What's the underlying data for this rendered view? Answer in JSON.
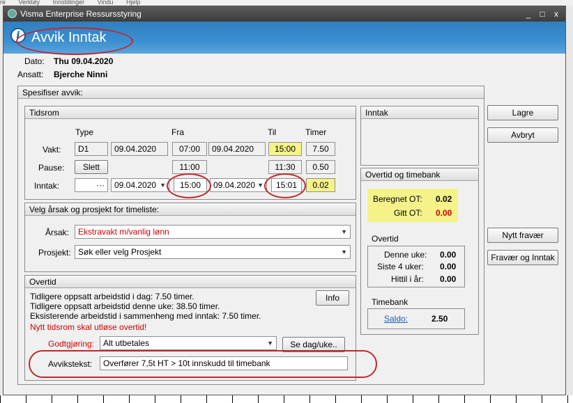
{
  "background_menu": [
    "re",
    "Verktøy",
    "Innstillinger",
    "Vindu",
    "Hjelp"
  ],
  "window": {
    "title": "Visma Enterprise Ressursstyring",
    "min": "_",
    "max": "□",
    "close": "x"
  },
  "header": {
    "title": "Avvik Inntak",
    "icon": "info-icon"
  },
  "info": {
    "date_label": "Dato:",
    "date_value": "Thu 09.04.2020",
    "employee_label": "Ansatt:",
    "employee_value": "Bjerche Ninni"
  },
  "spesifiser": {
    "title": "Spesifiser avvik:"
  },
  "tidsrom": {
    "title": "Tidsrom",
    "col_type": "Type",
    "col_fra": "Fra",
    "col_til": "Til",
    "col_timer": "Timer",
    "vakt": {
      "label": "Vakt:",
      "type": "D1",
      "date_from": "09.04.2020",
      "time_from": "07:00",
      "date_to": "09.04.2020",
      "time_to": "15:00",
      "hours": "7.50"
    },
    "pause": {
      "label": "Pause:",
      "button": "Slett",
      "time_from": "11:00",
      "time_to": "11:30",
      "hours": "0.50"
    },
    "inntak": {
      "label": "Inntak:",
      "ellipsis": "···",
      "date_from": "09.04.2020",
      "time_from": "15:00",
      "date_to": "09.04.2020",
      "time_to": "15:01",
      "hours": "0.02"
    }
  },
  "arsak": {
    "title": "Velg årsak og prosjekt for timeliste:",
    "arsak_label": "Årsak:",
    "arsak_value": "Ekstravakt m/vanlig lønn",
    "prosjekt_label": "Prosjekt:",
    "prosjekt_value": "Søk eller velg Prosjekt"
  },
  "overtid": {
    "title": "Overtid",
    "lines": [
      "Tidligere oppsatt arbeidstid i dag: 7.50 timer.",
      "Tidligere oppsatt arbeidstid denne uke: 38.50 timer.",
      "Eksisterende arbeidstid i sammenheng med inntak: 7.50 timer."
    ],
    "warning": "Nytt tidsrom skal utløse overtid!",
    "info_button": "Info",
    "godtgjoring_label": "Godtgjøring:",
    "godtgjoring_value": "Alt utbetales",
    "se_dag_button": "Se dag/uke..",
    "avvikstekst_label": "Avvikstekst:",
    "avvikstekst_value": "Overfører 7,5t HT > 10t innskudd til timebank"
  },
  "inntak_panel": {
    "title": "Inntak"
  },
  "ot_panel": {
    "title": "Overtid og timebank",
    "beregnet_label": "Beregnet OT:",
    "beregnet_value": "0.02",
    "gitt_label": "Gitt OT:",
    "gitt_value": "0.00",
    "overtid_title": "Overtid",
    "denne_uke_label": "Denne uke:",
    "denne_uke_value": "0.00",
    "siste4_label": "Siste 4 uker:",
    "siste4_value": "0.00",
    "hittil_label": "Hittil i år:",
    "hittil_value": "0.00",
    "timebank_title": "Timebank",
    "saldo_label": "Saldo:",
    "saldo_value": "2.50"
  },
  "buttons": {
    "lagre": "Lagre",
    "avbryt": "Avbryt",
    "nytt_fravaer": "Nytt fravær",
    "fravaer_inntak": "Fravær og Inntak"
  },
  "colors": {
    "header_blue": "#2f7fc0",
    "highlight_yellow": "#f5f28a",
    "annotation_red": "#c0282c",
    "warning_red": "#d00000"
  }
}
